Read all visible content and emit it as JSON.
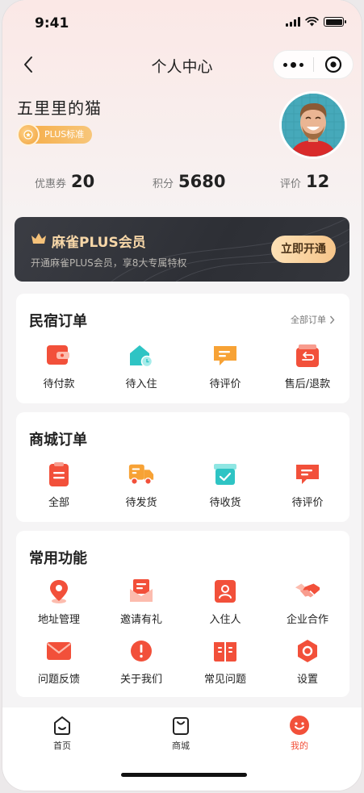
{
  "status_bar": {
    "time": "9:41"
  },
  "navbar": {
    "title": "个人中心",
    "back_icon": "chevron-left-icon",
    "more_icon": "more-dots-icon",
    "close_icon": "target-close-icon"
  },
  "profile": {
    "name": "五里里的猫",
    "badge": "PLUS标准"
  },
  "stats": [
    {
      "label": "优惠券",
      "value": "20"
    },
    {
      "label": "积分",
      "value": "5680"
    },
    {
      "label": "评价",
      "value": "12"
    }
  ],
  "plus_card": {
    "title": "麻雀PLUS会员",
    "description": "开通麻雀PLUS会员，享8大专属特权",
    "button": "立即开通",
    "accent": "#f7d7a8"
  },
  "homestay_orders": {
    "title": "民宿订单",
    "all_link": "全部订单",
    "items": [
      {
        "label": "待付款",
        "icon": "wallet-icon"
      },
      {
        "label": "待入住",
        "icon": "house-clock-icon"
      },
      {
        "label": "待评价",
        "icon": "comment-icon"
      },
      {
        "label": "售后/退款",
        "icon": "refund-icon"
      }
    ]
  },
  "mall_orders": {
    "title": "商城订单",
    "items": [
      {
        "label": "全部",
        "icon": "clipboard-icon"
      },
      {
        "label": "待发货",
        "icon": "truck-icon"
      },
      {
        "label": "待收货",
        "icon": "box-check-icon"
      },
      {
        "label": "待评价",
        "icon": "comment-icon"
      }
    ]
  },
  "common_functions": {
    "title": "常用功能",
    "items": [
      {
        "label": "地址管理",
        "icon": "location-pin-icon"
      },
      {
        "label": "邀请有礼",
        "icon": "envelope-gift-icon"
      },
      {
        "label": "入住人",
        "icon": "person-card-icon"
      },
      {
        "label": "企业合作",
        "icon": "handshake-icon"
      },
      {
        "label": "问题反馈",
        "icon": "mail-icon"
      },
      {
        "label": "关于我们",
        "icon": "info-alert-icon"
      },
      {
        "label": "常见问题",
        "icon": "book-icon"
      },
      {
        "label": "设置",
        "icon": "gear-icon"
      }
    ]
  },
  "tabbar": {
    "items": [
      {
        "label": "首页",
        "icon": "home-smile-icon",
        "active": false
      },
      {
        "label": "商城",
        "icon": "shopping-bag-icon",
        "active": false
      },
      {
        "label": "我的",
        "icon": "profile-smile-icon",
        "active": true
      }
    ]
  },
  "colors": {
    "primary": "#f2503a",
    "teal": "#2ec4c4",
    "orange": "#f7a235",
    "dark_card": "#2f3137"
  }
}
